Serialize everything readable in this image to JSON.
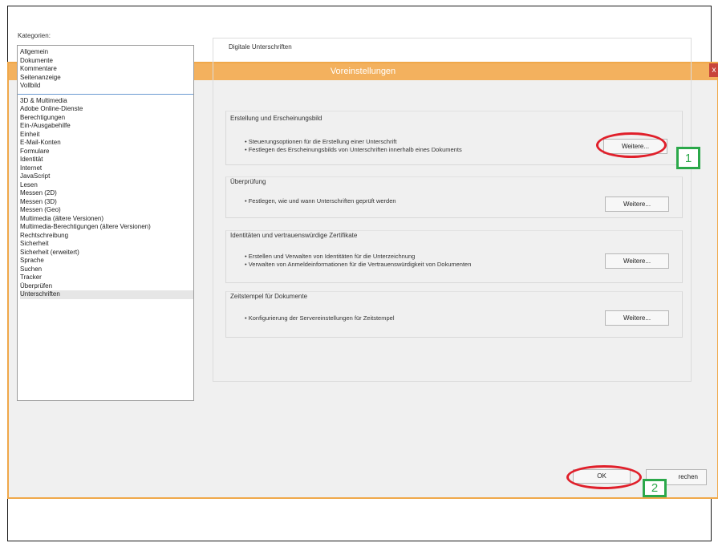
{
  "dialog": {
    "title": "Voreinstellungen",
    "close_label": "x"
  },
  "categories": {
    "label": "Kategorien:",
    "top_items": [
      "Allgemein",
      "Dokumente",
      "Kommentare",
      "Seitenanzeige",
      "Vollbild"
    ],
    "items": [
      "3D & Multimedia",
      "Adobe Online-Dienste",
      "Berechtigungen",
      "Ein-/Ausgabehilfe",
      "Einheit",
      "E-Mail-Konten",
      "Formulare",
      "Identität",
      "Internet",
      "JavaScript",
      "Lesen",
      "Messen (2D)",
      "Messen (3D)",
      "Messen (Geo)",
      "Multimedia (ältere Versionen)",
      "Multimedia-Berechtigungen (ältere Versionen)",
      "Rechtschreibung",
      "Sicherheit",
      "Sicherheit (erweitert)",
      "Sprache",
      "Suchen",
      "Tracker",
      "Überprüfen",
      "Unterschriften"
    ],
    "selected": "Unterschriften"
  },
  "panel": {
    "title": "Digitale Unterschriften",
    "sections": [
      {
        "title": "Erstellung und Erscheinungsbild",
        "bullets": [
          "Steuerungsoptionen für die Erstellung einer Unterschrift",
          "Festlegen des Erscheinungsbilds von Unterschriften innerhalb eines Dokuments"
        ],
        "button": "Weitere..."
      },
      {
        "title": "Überprüfung",
        "bullets": [
          "Festlegen, wie und wann Unterschriften geprüft werden"
        ],
        "button": "Weitere..."
      },
      {
        "title": "Identitäten und vertrauenswürdige Zertifikate",
        "bullets": [
          "Erstellen und Verwalten von Identitäten für die Unterzeichnung",
          "Verwalten von Anmeldeinformationen für die Vertrauenswürdigkeit von Dokumenten"
        ],
        "button": "Weitere..."
      },
      {
        "title": "Zeitstempel für Dokumente",
        "bullets": [
          "Konfigurierung der Servereinstellungen für Zeitstempel"
        ],
        "button": "Weitere..."
      }
    ]
  },
  "footer": {
    "ok_label": "OK",
    "cancel_label": "rechen"
  },
  "annotations": {
    "marker_1": "1",
    "marker_2": "2",
    "ring_color": "#e01f2a",
    "marker_color": "#2ba84a"
  }
}
